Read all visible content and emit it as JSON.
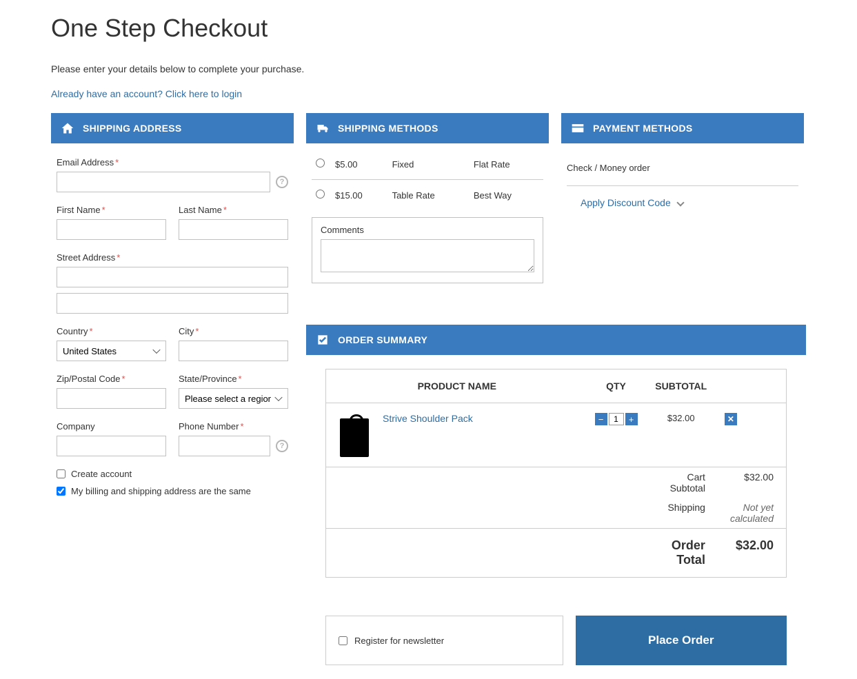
{
  "page": {
    "title": "One Step Checkout",
    "intro": "Please enter your details below to complete your purchase.",
    "login_link": "Already have an account? Click here to login"
  },
  "shipping_address": {
    "header": "SHIPPING ADDRESS",
    "labels": {
      "email": "Email Address",
      "first_name": "First Name",
      "last_name": "Last Name",
      "street": "Street Address",
      "country": "Country",
      "city": "City",
      "zip": "Zip/Postal Code",
      "state": "State/Province",
      "company": "Company",
      "phone": "Phone Number"
    },
    "country_value": "United States",
    "state_placeholder": "Please select a region",
    "create_account": "Create account",
    "billing_same": "My billing and shipping address are the same"
  },
  "shipping_methods": {
    "header": "SHIPPING METHODS",
    "options": [
      {
        "price": "$5.00",
        "type": "Fixed",
        "name": "Flat Rate"
      },
      {
        "price": "$15.00",
        "type": "Table Rate",
        "name": "Best Way"
      }
    ],
    "comments_label": "Comments"
  },
  "payment_methods": {
    "header": "PAYMENT METHODS",
    "option": "Check / Money order",
    "discount_link": "Apply Discount Code"
  },
  "order_summary": {
    "header": "ORDER SUMMARY",
    "columns": {
      "product": "PRODUCT NAME",
      "qty": "QTY",
      "subtotal": "SUBTOTAL"
    },
    "items": [
      {
        "name": "Strive Shoulder Pack",
        "qty": "1",
        "subtotal": "$32.00"
      }
    ],
    "cart_subtotal_label": "Cart Subtotal",
    "cart_subtotal": "$32.00",
    "shipping_label": "Shipping",
    "shipping_value": "Not yet calculated",
    "order_total_label": "Order Total",
    "order_total": "$32.00"
  },
  "bottom": {
    "newsletter": "Register for newsletter",
    "place_order": "Place Order"
  }
}
